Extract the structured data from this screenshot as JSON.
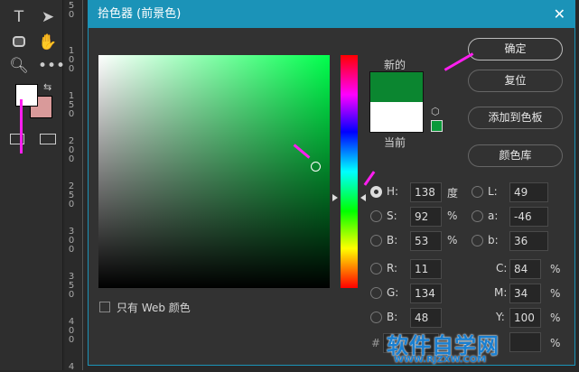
{
  "dialog": {
    "title": "拾色器 (前景色)",
    "close": "✕"
  },
  "swatch": {
    "new_label": "新的",
    "current_label": "当前",
    "new_color": "#0b8630",
    "current_color": "#ffffff"
  },
  "buttons": {
    "ok": "确定",
    "reset": "复位",
    "add_swatch": "添加到色板",
    "libraries": "颜色库"
  },
  "web_only": {
    "label": "只有 Web 颜色",
    "checked": false
  },
  "hsb": {
    "h": {
      "label": "H:",
      "value": "138",
      "unit": "度"
    },
    "s": {
      "label": "S:",
      "value": "92",
      "unit": "%"
    },
    "b": {
      "label": "B:",
      "value": "53",
      "unit": "%"
    }
  },
  "rgb": {
    "r": {
      "label": "R:",
      "value": "11"
    },
    "g": {
      "label": "G:",
      "value": "134"
    },
    "b": {
      "label": "B:",
      "value": "48"
    }
  },
  "lab": {
    "l": {
      "label": "L:",
      "value": "49"
    },
    "a": {
      "label": "a:",
      "value": "-46"
    },
    "b": {
      "label": "b:",
      "value": "36"
    }
  },
  "cmyk": {
    "c": {
      "label": "C:",
      "value": "84",
      "unit": "%"
    },
    "m": {
      "label": "M:",
      "value": "34",
      "unit": "%"
    },
    "y": {
      "label": "Y:",
      "value": "100",
      "unit": "%"
    },
    "k_unit": "%"
  },
  "hex": {
    "label": "#"
  },
  "toolbar": {
    "type_tool": "T",
    "foreground": "#ffffff",
    "background": "#d99a9a"
  },
  "ruler": [
    "5\n0",
    "1\n0\n0",
    "1\n5\n0",
    "2\n0\n0",
    "2\n5\n0",
    "3\n0\n0",
    "3\n5\n0",
    "4\n0\n0",
    "4"
  ],
  "watermark": {
    "title": "软件自学网",
    "url": "WWW.RJZXW.COM"
  }
}
